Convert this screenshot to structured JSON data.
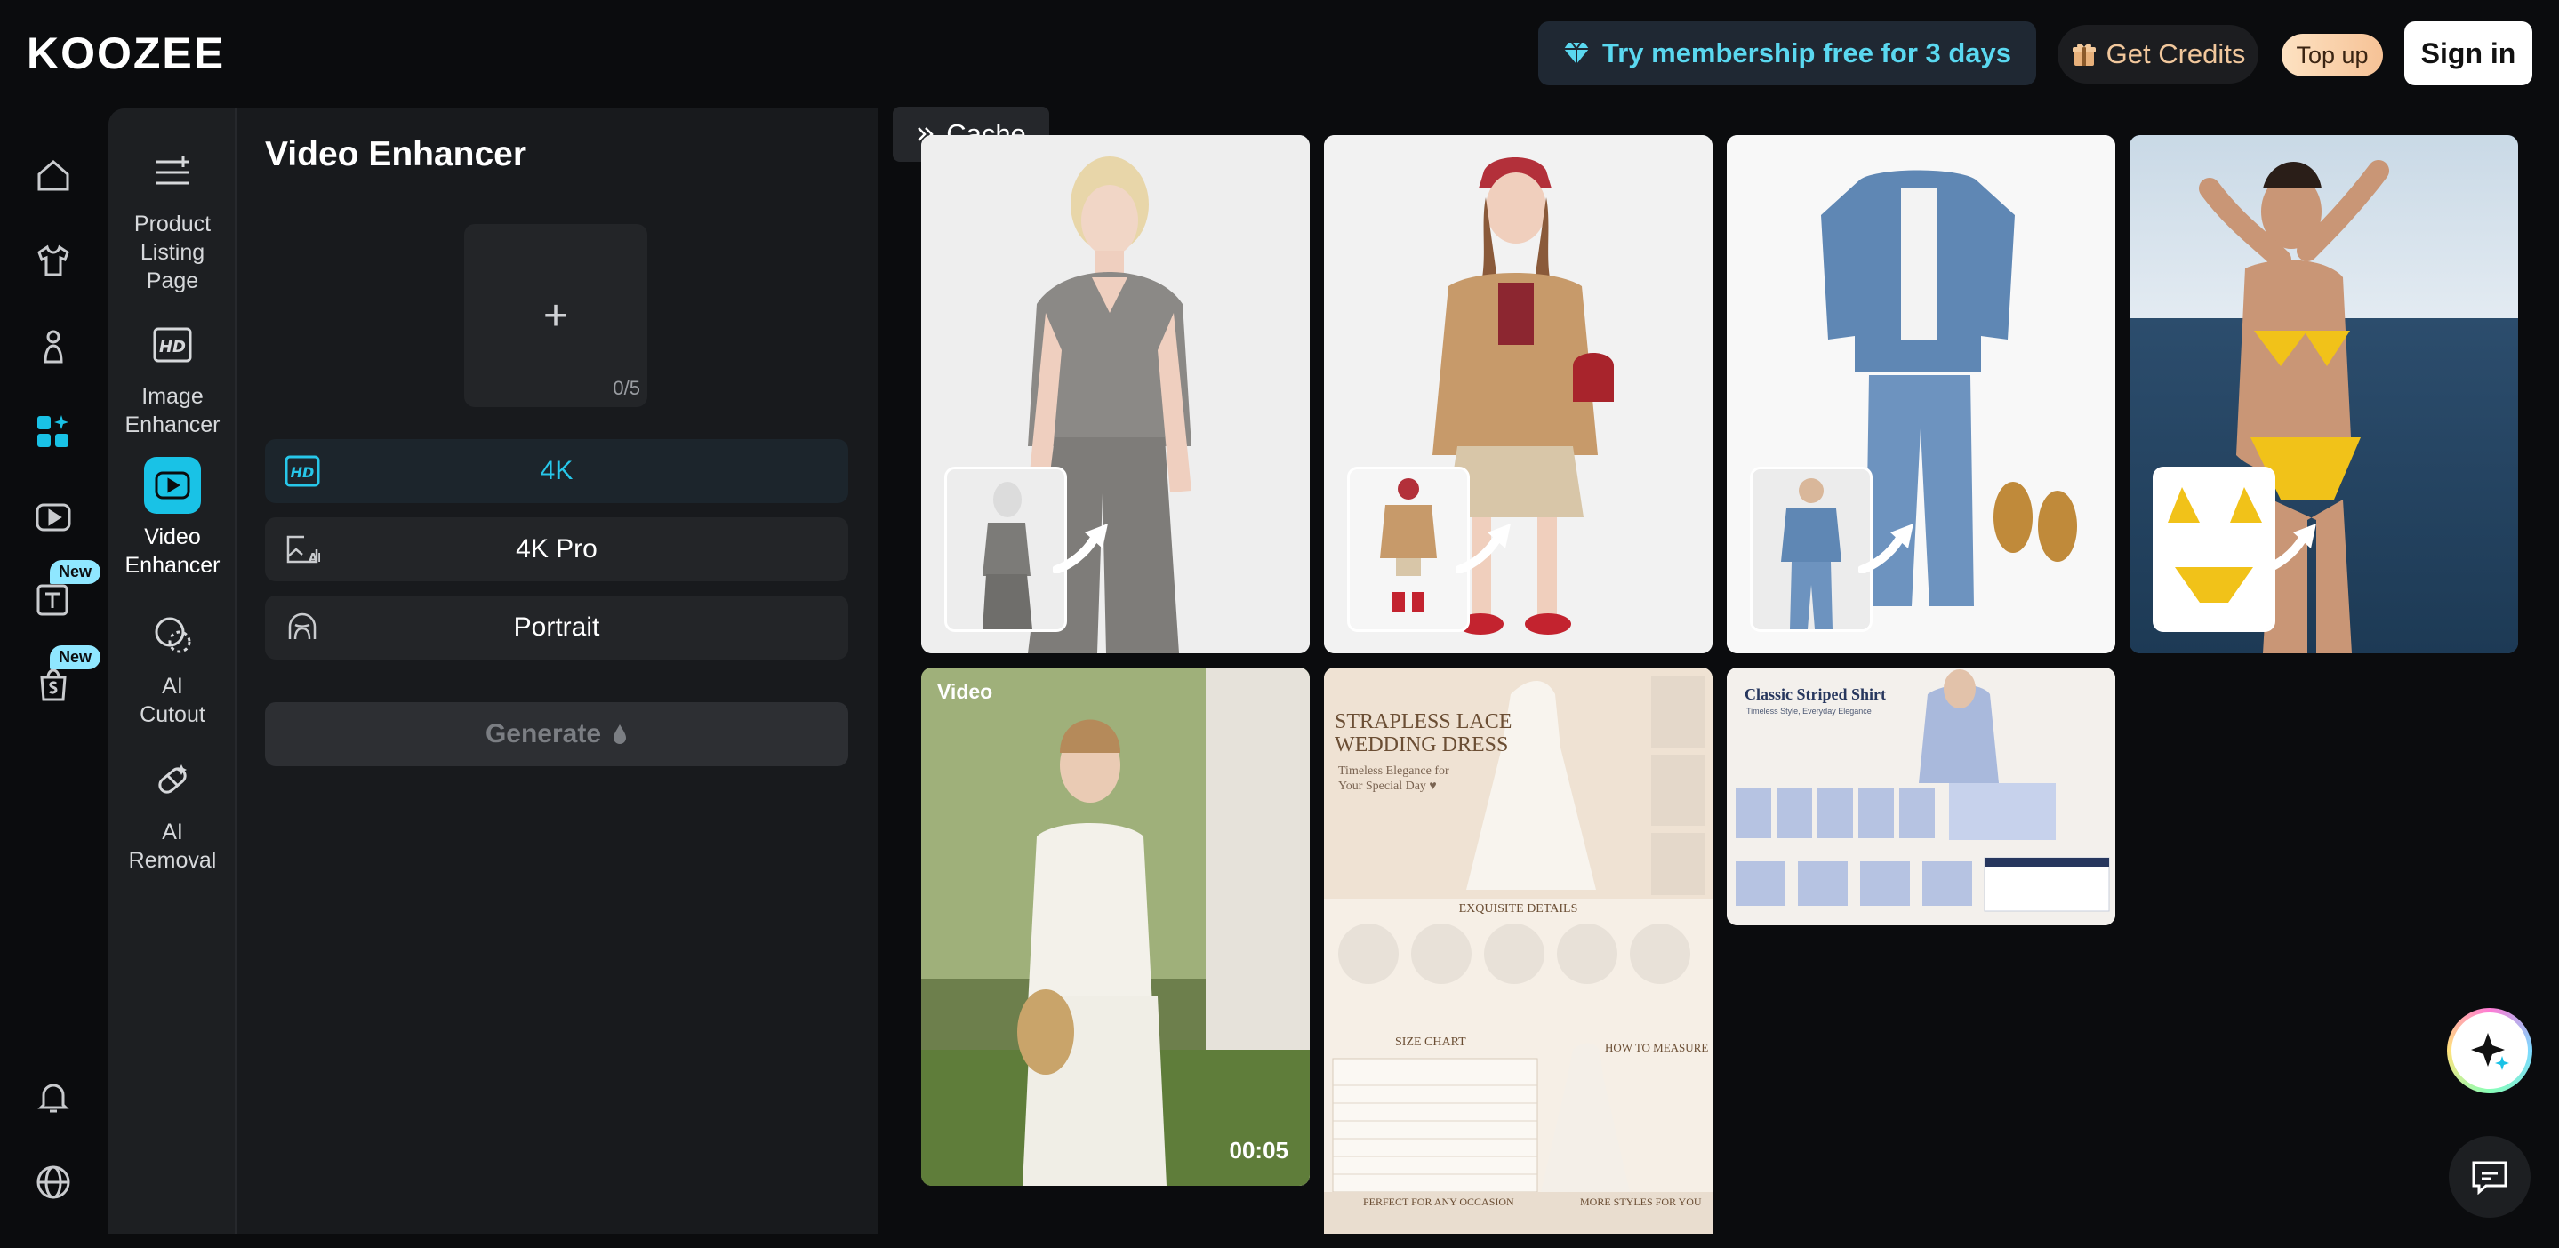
{
  "brand": {
    "logo_text": "KOOZEE"
  },
  "header": {
    "membership_label": "Try membership free for 3 days",
    "credits_label": "Get Credits",
    "topup_label": "Top up",
    "signin_label": "Sign in"
  },
  "rail": {
    "items": [
      {
        "name": "home-icon"
      },
      {
        "name": "shirt-icon"
      },
      {
        "name": "model-icon"
      },
      {
        "name": "apps-icon",
        "active": true
      },
      {
        "name": "play-icon"
      },
      {
        "name": "text-icon",
        "badge": "New"
      },
      {
        "name": "bag-icon",
        "badge": "New"
      }
    ],
    "bottom": [
      {
        "name": "bell-icon"
      },
      {
        "name": "globe-icon"
      }
    ]
  },
  "subnav": {
    "items": [
      {
        "label": "Product\nListing\nPage",
        "icon": "list-plus-icon"
      },
      {
        "label": "Image\nEnhancer",
        "icon": "hd-icon"
      },
      {
        "label": "Video\nEnhancer",
        "icon": "video-icon",
        "active": true
      },
      {
        "label": "AI\nCutout",
        "icon": "cutout-icon"
      },
      {
        "label": "AI\nRemoval",
        "icon": "eraser-icon"
      }
    ]
  },
  "tool": {
    "title": "Video Enhancer",
    "upload_count": "0/5",
    "options": [
      {
        "label": "4K",
        "icon": "hd-badge-icon",
        "active": true
      },
      {
        "label": "4K Pro",
        "icon": "ai-image-icon"
      },
      {
        "label": "Portrait",
        "icon": "portrait-icon"
      }
    ],
    "generate_label": "Generate"
  },
  "cache": {
    "label": "Cache"
  },
  "gallery": {
    "video_label": "Video",
    "video_duration": "00:05",
    "listing_title": "STRAPLESS LACE\nWEDDING DRESS",
    "listing_subtitle": "Timeless Elegance for\nYour Special Day ♥",
    "listing_details": "EXQUISITE DETAILS",
    "listing_size": "SIZE CHART",
    "listing_measure": "HOW TO MEASURE",
    "listing_occasion": "PERFECT FOR ANY OCCASION",
    "listing_more": "MORE STYLES FOR YOU",
    "shirt_title": "Classic Striped Shirt",
    "shirt_subtitle": "Timeless Style, Everyday Elegance"
  },
  "colors": {
    "accent": "#19c2e6",
    "membership_text": "#5ad8f0",
    "background": "#0b0c0e"
  }
}
